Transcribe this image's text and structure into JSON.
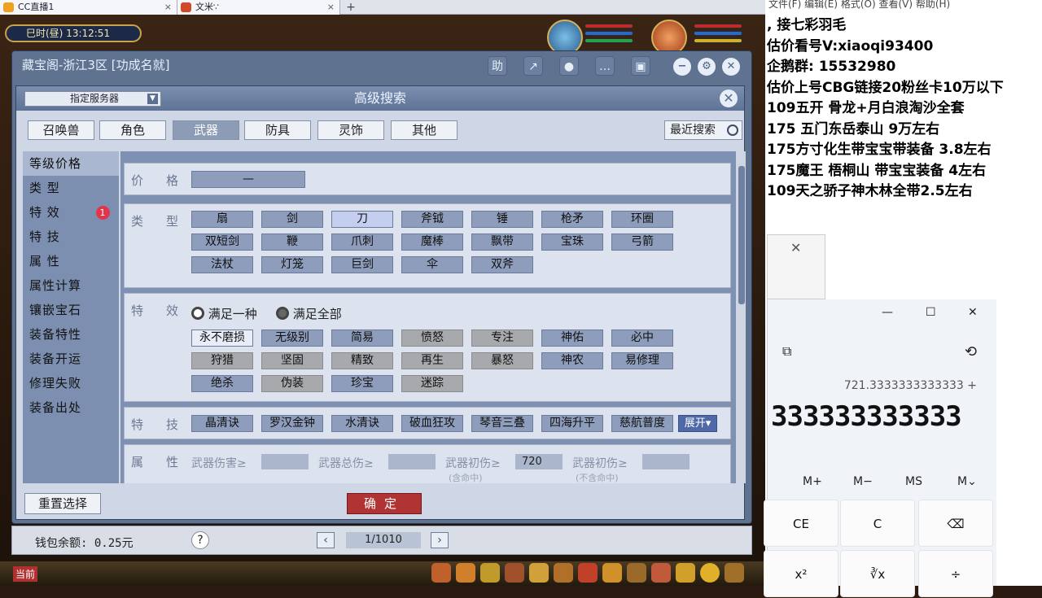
{
  "browser": {
    "tabs": [
      {
        "label": "CC直播1",
        "close": "×"
      },
      {
        "label": "文米∵",
        "close": "×"
      }
    ],
    "new_tab": "+"
  },
  "game": {
    "clock": "巳时(昼)   13:12:51",
    "window_title": "藏宝阁-浙江3区 [功成名就]",
    "toolbar": {
      "help": "助",
      "close": "✕",
      "gear": "⚙",
      "min": "−"
    },
    "search": {
      "title": "高级搜索",
      "server_select": "指定服务器",
      "close": "✕",
      "categories": [
        "召唤兽",
        "角色",
        "武器",
        "防具",
        "灵饰",
        "其他"
      ],
      "active_category": "武器",
      "recent": "最近搜索",
      "sidebar": [
        "等级价格",
        "类    型",
        "特    效",
        "特    技",
        "属    性",
        "属性计算",
        "镶嵌宝石",
        "装备特性",
        "装备开运",
        "修理失败",
        "装备出处"
      ],
      "sidebar_badge": "1",
      "price_label": "价格",
      "price_sep": "—",
      "type_label": "类型",
      "types": [
        "扇",
        "剑",
        "刀",
        "斧钺",
        "锤",
        "枪矛",
        "环圈",
        "双短剑",
        "鞭",
        "爪刺",
        "魔棒",
        "飘带",
        "宝珠",
        "弓箭",
        "法杖",
        "灯笼",
        "巨剑",
        "伞",
        "双斧"
      ],
      "effect_label": "特效",
      "effect_modes": [
        "满足一种",
        "满足全部"
      ],
      "effects": [
        "永不磨损",
        "无级别",
        "简易",
        "愤怒",
        "专注",
        "神佑",
        "必中",
        "狩猎",
        "坚固",
        "精致",
        "再生",
        "暴怒",
        "神农",
        "易修理",
        "绝杀",
        "伪装",
        "珍宝",
        "迷踪"
      ],
      "skill_label": "特技",
      "skills": [
        "晶清诀",
        "罗汉金钟",
        "水清诀",
        "破血狂攻",
        "琴音三叠",
        "四海升平",
        "慈航普度"
      ],
      "expand": "展开▾",
      "attr_label": "属性",
      "attrs": [
        {
          "label": "武器伤害≥",
          "value": "",
          "note": ""
        },
        {
          "label": "武器总伤≥",
          "value": "",
          "note": ""
        },
        {
          "label": "武器初伤≥",
          "value": "720",
          "note": "(含命中)"
        },
        {
          "label": "武器初伤≥",
          "value": "",
          "note": "(不含命中)"
        }
      ],
      "reset": "重置选择",
      "confirm": "确定"
    },
    "footer": {
      "balance": "钱包余额: 0.25元",
      "help": "?",
      "page": "1/1010",
      "prev": "‹",
      "next": "›"
    },
    "bottom_left": "当前"
  },
  "stream_text": {
    "menu": "文件(F)   编辑(E)   格式(O)   查看(V)   帮助(H)",
    "lines": [
      ",      接七彩羽毛",
      "估价看号V:xiaoqi93400",
      "企鹅群:  15532980",
      "估价上号CBG链接20粉丝卡10万以下",
      "109五开 骨龙+月白浪淘沙全套",
      "175 五门东岳泰山  9万左右",
      "175方寸化生带宝宝带装备  3.8左右",
      "175魔王 梧桐山  带宝宝装备 4左右",
      "109天之骄子神木林全带2.5左右"
    ]
  },
  "calculator": {
    "expression": "721.3333333333333 +",
    "display": "333333333333",
    "memory": [
      "M+",
      "M−",
      "MS",
      "M⌄"
    ],
    "keys": [
      "CE",
      "C",
      "⌫",
      "x²",
      "∛x",
      "÷"
    ],
    "window": {
      "min": "—",
      "max": "☐",
      "close": "✕"
    }
  }
}
